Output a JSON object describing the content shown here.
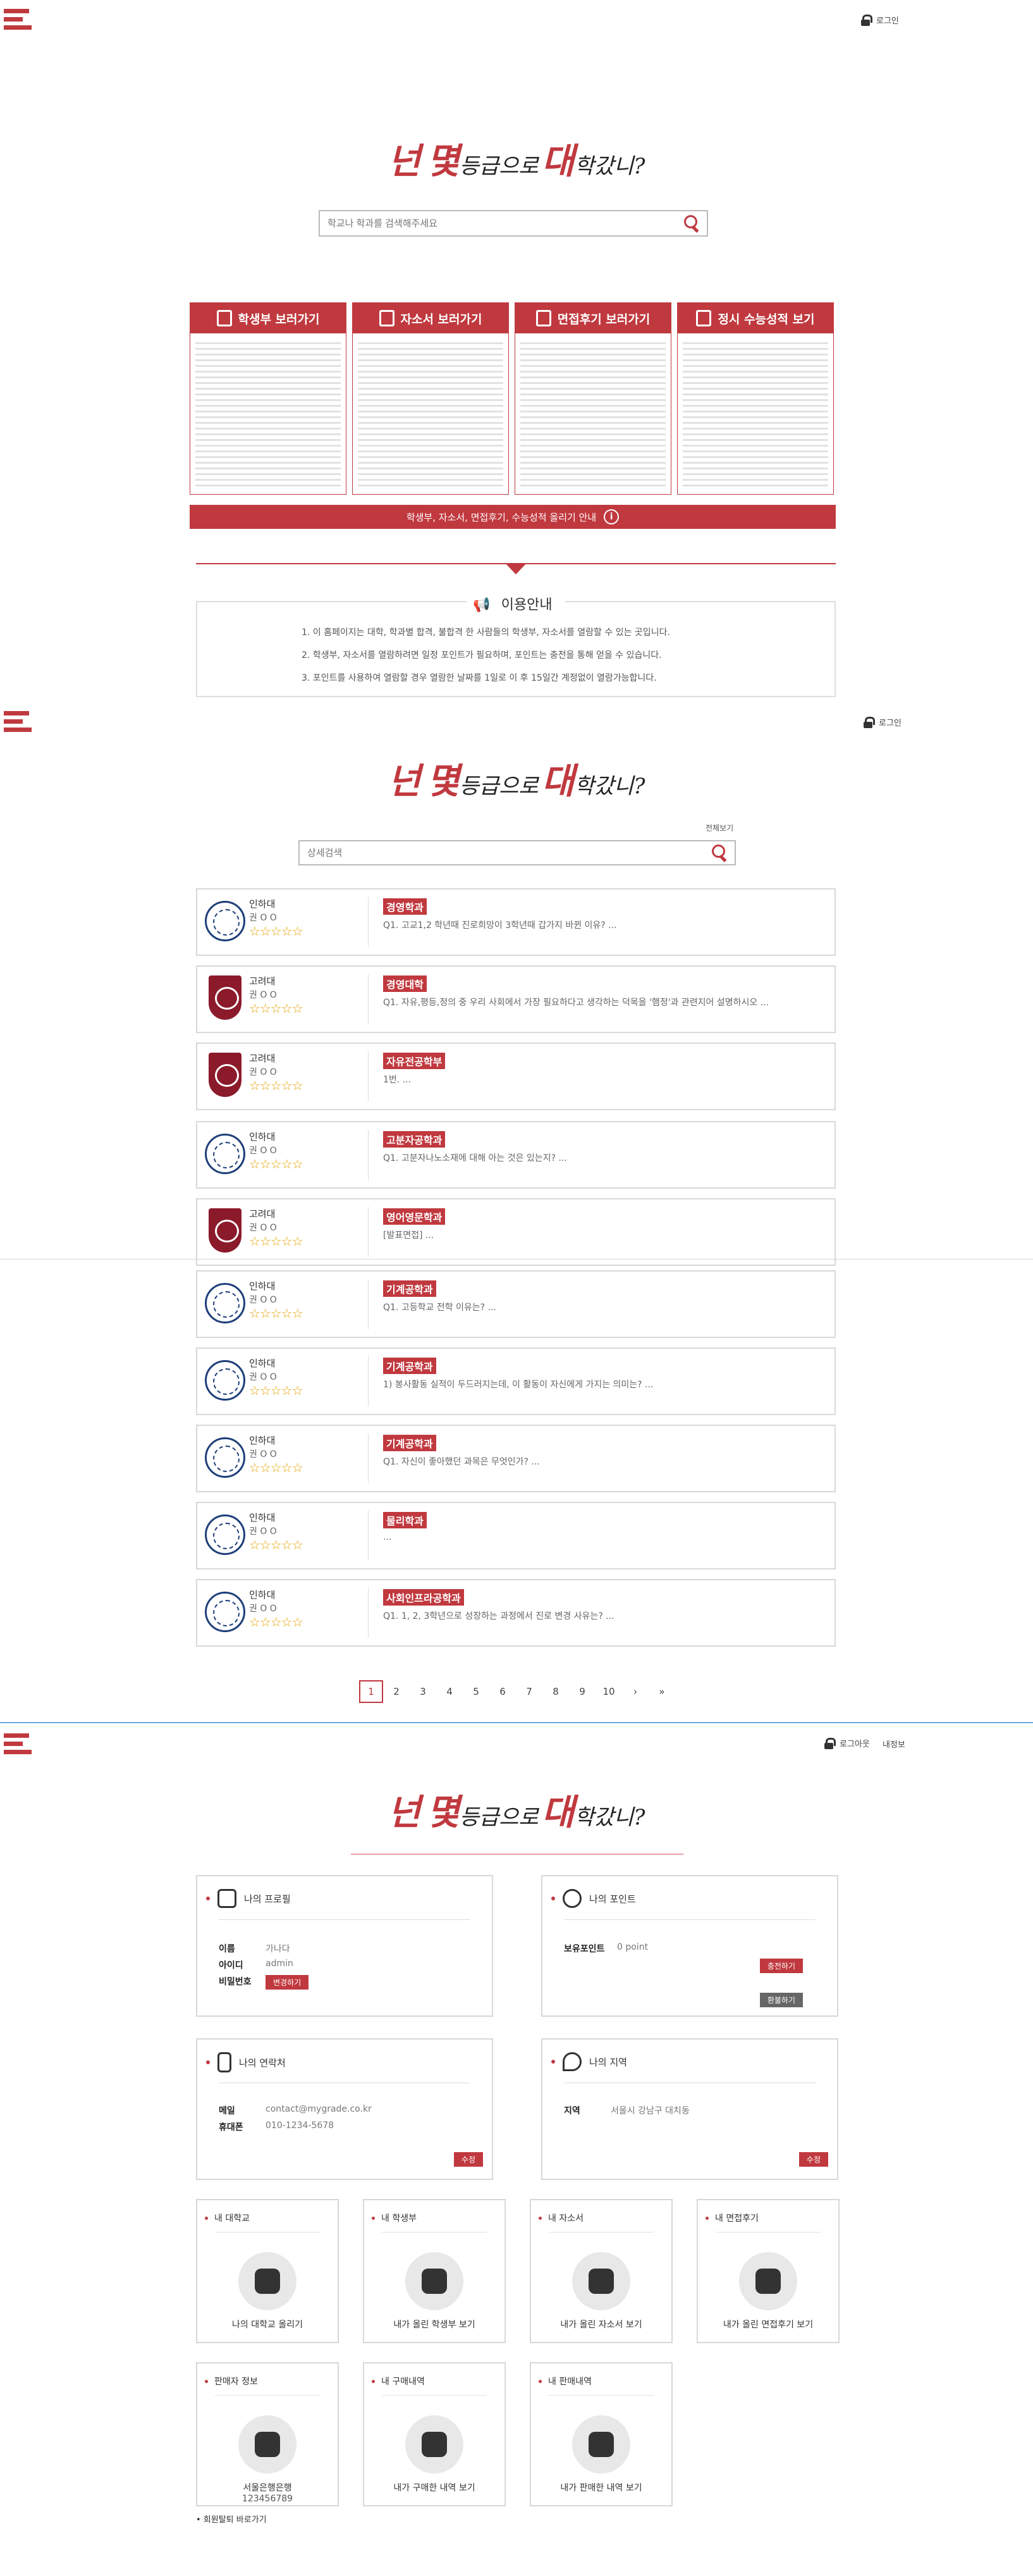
{
  "header": {
    "login_label": "로그인"
  },
  "header3": {
    "logout_label": "로그아웃",
    "myinfo_label": "내정보"
  },
  "logo": {
    "a": "넌",
    "b": "몇",
    "c": "등급으로",
    "d": "대",
    "e": "학갔니?"
  },
  "home": {
    "search_placeholder": "학교나 학과를 검색해주세요",
    "categories": [
      {
        "label": "학생부 보러가기",
        "icon": "user-icon"
      },
      {
        "label": "자소서 보러가기",
        "icon": "document-icon"
      },
      {
        "label": "면접후기 보러가기",
        "icon": "microphone-icon"
      },
      {
        "label": "정시 수능성적 보기",
        "icon": "school-icon"
      }
    ],
    "upload_bar": "학생부, 자소서, 면접후기, 수능성적 올리기 안내",
    "notice_title": "이용안내",
    "notices": [
      "1. 이 홈페이지는 대학, 학과별 합격, 불합격 한 사람들의 학생부, 자소서를 열람할 수 있는 곳입니다.",
      "2. 학생부, 자소서를 열람하려면 일정 포인트가 필요하며, 포인트는 충전을 통해 얻을 수 있습니다.",
      "3. 포인트를 사용하여 열람할 경우 열람한 날짜를 1일로 이 후 15일간 계정없이 열람가능합니다."
    ]
  },
  "list": {
    "view_all": "전체보기",
    "search_placeholder": "상세검색",
    "reviews": [
      {
        "uni": "인하대",
        "user": "권 O O",
        "stars": "☆☆☆☆☆",
        "dept": "경영학과",
        "q": "Q1. 고교1,2 학년때 진로희망이 3학년때 갑가지 바뀐 이유? ...",
        "emblem": "inha"
      },
      {
        "uni": "고려대",
        "user": "권 O O",
        "stars": "☆☆☆☆☆",
        "dept": "경영대학",
        "q": "Q1. 자유,평등,정의 중 우리 사회에서 가장 필요하다고 생각하는 덕목을 '햄정'과 관련지어 설명하시오 ...",
        "emblem": "korea"
      },
      {
        "uni": "고려대",
        "user": "권 O O",
        "stars": "☆☆☆☆☆",
        "dept": "자유전공학부",
        "q": "1번. ...",
        "emblem": "korea"
      },
      {
        "uni": "인하대",
        "user": "권 O O",
        "stars": "☆☆☆☆☆",
        "dept": "고분자공학과",
        "q": "Q1. 고분자나노소재에 대해 아는 것은 있는지? ...",
        "emblem": "inha"
      },
      {
        "uni": "고려대",
        "user": "권 O O",
        "stars": "☆☆☆☆☆",
        "dept": "영어영문학과",
        "q": "[발표면접] ...",
        "emblem": "korea"
      },
      {
        "uni": "인하대",
        "user": "권 O O",
        "stars": "☆☆☆☆☆",
        "dept": "기계공학과",
        "q": "Q1. 고등학교 전학 이유는? ...",
        "emblem": "inha"
      },
      {
        "uni": "인하대",
        "user": "권 O O",
        "stars": "☆☆☆☆☆",
        "dept": "기계공학과",
        "q": "1) 봉사활동 실적이 두드러지는데, 이 활동이 자신에게 가지는 의미는? ...",
        "emblem": "inha"
      },
      {
        "uni": "인하대",
        "user": "권 O O",
        "stars": "☆☆☆☆☆",
        "dept": "기계공학과",
        "q": "Q1. 자신이 좋아했던 과목은 무엇인가? ...",
        "emblem": "inha"
      },
      {
        "uni": "인하대",
        "user": "권 O O",
        "stars": "☆☆☆☆☆",
        "dept": "물리학과",
        "q": "...",
        "emblem": "inha"
      },
      {
        "uni": "인하대",
        "user": "권 O O",
        "stars": "☆☆☆☆☆",
        "dept": "사회인프라공학과",
        "q": "Q1. 1, 2, 3학년으로 성장하는 과정에서 진로 변경 사유는? ...",
        "emblem": "inha"
      }
    ],
    "pages": [
      "1",
      "2",
      "3",
      "4",
      "5",
      "6",
      "7",
      "8",
      "9",
      "10",
      "›",
      "»"
    ]
  },
  "mypage": {
    "profile": {
      "title": "나의 프로필",
      "name_k": "이름",
      "name_v": "가나다",
      "id_k": "아이디",
      "id_v": "admin",
      "pw_k": "비밀번호",
      "pw_btn": "변경하기"
    },
    "points": {
      "title": "나의 포인트",
      "k": "보유포인트",
      "v": "0 point",
      "charge": "충전하기",
      "refund": "환불하기"
    },
    "contact": {
      "title": "나의 연락처",
      "mail_k": "메일",
      "mail_v": "contact@mygrade.co.kr",
      "phone_k": "휴대폰",
      "phone_v": "010-1234-5678",
      "edit": "수정"
    },
    "region": {
      "title": "나의 지역",
      "k": "지역",
      "v": "서울시 강남구 대치동",
      "edit": "수정"
    },
    "tiles": [
      {
        "title": "내 대학교",
        "label": "나의 대학교 올리기",
        "icon": "graduation-cap-icon"
      },
      {
        "title": "내 학생부",
        "label": "내가 올린 학생부 보기",
        "icon": "user-icon"
      },
      {
        "title": "내 자소서",
        "label": "내가 올린 자소서 보기",
        "icon": "document-icon"
      },
      {
        "title": "내 면접후기",
        "label": "내가 올린 면접후기 보기",
        "icon": "microphone-icon"
      },
      {
        "title": "판매자 정보",
        "label": "서울은행은행",
        "label2": "123456789",
        "icon": "money-icon"
      },
      {
        "title": "내 구매내역",
        "label": "내가 구매한 내역 보기",
        "icon": "cart-icon"
      },
      {
        "title": "내 판매내역",
        "label": "내가 판매한 내역 보기",
        "icon": "scroll-icon"
      }
    ],
    "withdraw": "• 회원탈퇴 바로가기"
  }
}
